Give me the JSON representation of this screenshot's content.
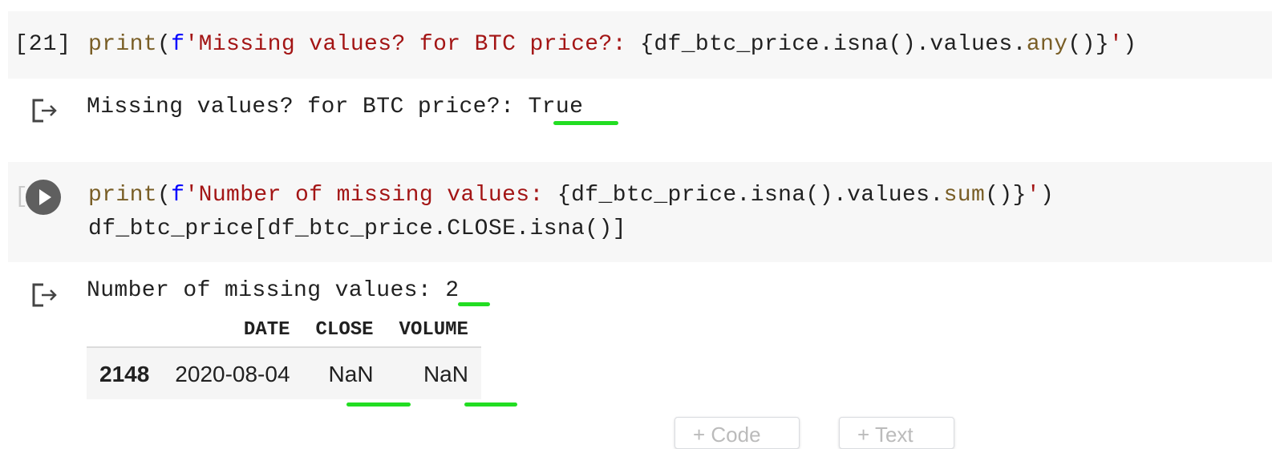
{
  "cells": [
    {
      "exec_count": "[21]",
      "code": {
        "fn": "print",
        "paren_open": "(",
        "fprefix": "f",
        "str_open": "'Missing values? for BTC price?: ",
        "expr": "{df_btc_price.isna().values.",
        "method": "any",
        "expr_end": "()}",
        "str_close": "'",
        "paren_close": ")"
      },
      "output": {
        "text": "Missing values? for BTC price?: ",
        "value": "True"
      }
    },
    {
      "exec_count": "[ ]",
      "code": {
        "fn": "print",
        "paren_open": "(",
        "fprefix": "f",
        "str_open": "'Number of missing values: ",
        "expr": "{df_btc_price.isna().values.",
        "method": "sum",
        "expr_end": "()}",
        "str_close": "'",
        "paren_close": ")",
        "line2": "df_btc_price[df_btc_price.CLOSE.isna()]"
      },
      "output": {
        "text": "Number of missing values: ",
        "value": "2",
        "table": {
          "columns": [
            "DATE",
            "CLOSE",
            "VOLUME"
          ],
          "rows": [
            {
              "index": "2148",
              "DATE": "2020-08-04",
              "CLOSE": "NaN",
              "VOLUME": "NaN"
            }
          ]
        }
      }
    }
  ],
  "toolbar": {
    "add_code_label": "+ Code",
    "add_text_label": "+ Text"
  },
  "colors": {
    "highlight": "#22dd22",
    "cell_bg": "#f7f7f7",
    "keyword": "#795e26",
    "fstring_prefix": "#0000ff",
    "string": "#a31515"
  },
  "icons": {
    "run": "play-icon",
    "output": "output-arrow-icon"
  }
}
